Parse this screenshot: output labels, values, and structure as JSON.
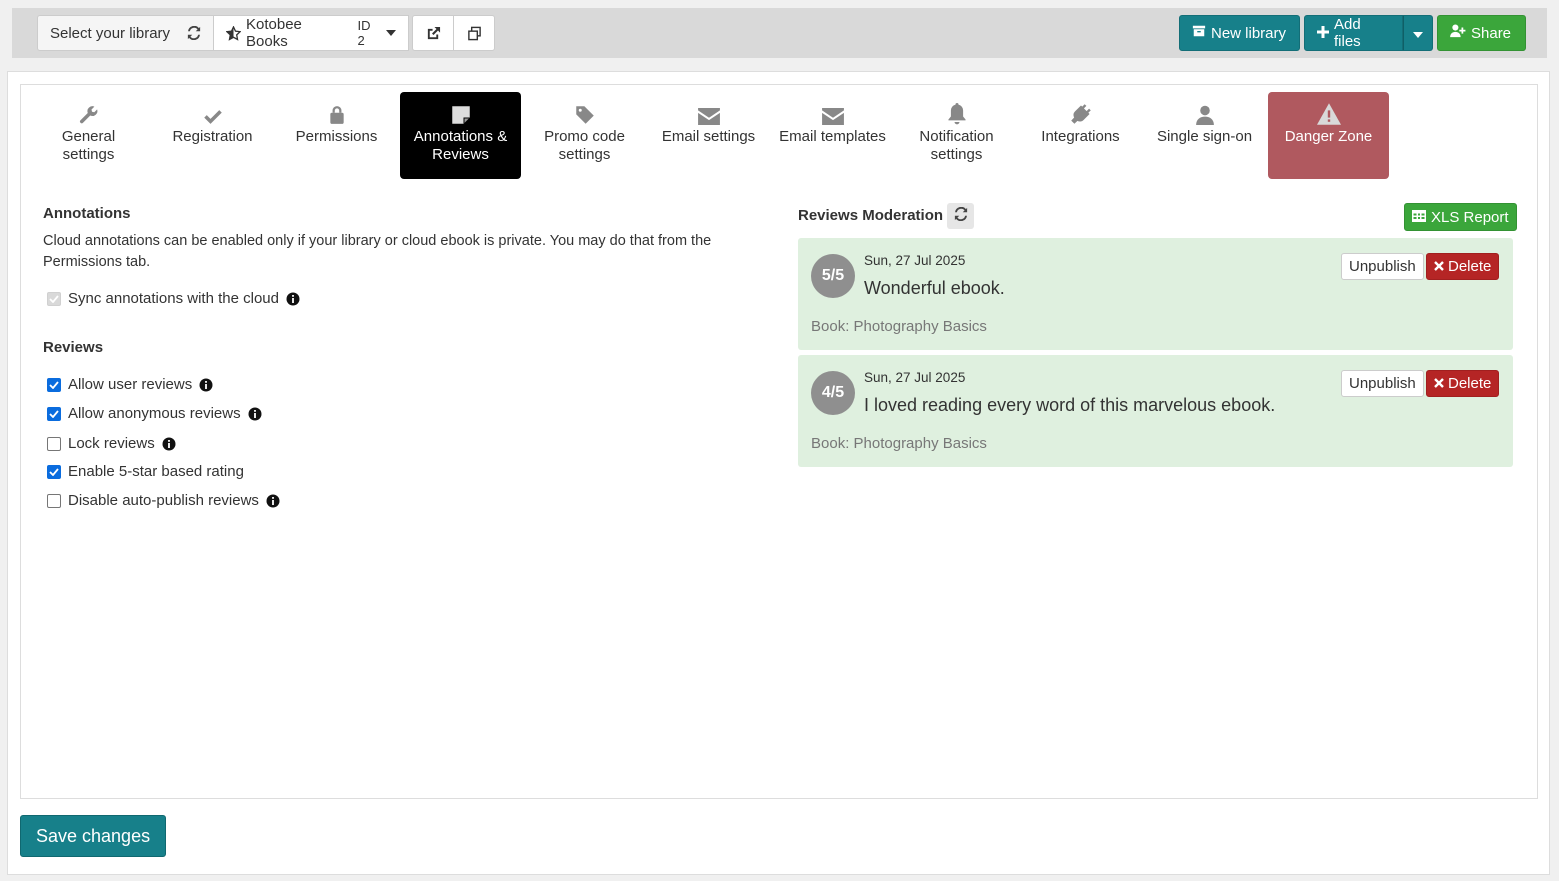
{
  "toolbar": {
    "select_library": "Select your library",
    "library_name": "Kotobee Books",
    "library_id": "ID 2",
    "new_library": "New library",
    "add_files": "Add files",
    "share": "Share"
  },
  "tabs": [
    {
      "label": "General settings",
      "icon": "wrench-icon"
    },
    {
      "label": "Registration",
      "icon": "check-icon"
    },
    {
      "label": "Permissions",
      "icon": "lock-icon"
    },
    {
      "label": "Annotations & Reviews",
      "icon": "note-icon",
      "active": true
    },
    {
      "label": "Promo code settings",
      "icon": "tag-icon"
    },
    {
      "label": "Email settings",
      "icon": "envelope-icon"
    },
    {
      "label": "Email templates",
      "icon": "envelope-icon"
    },
    {
      "label": "Notification settings",
      "icon": "bell-icon"
    },
    {
      "label": "Integrations",
      "icon": "plug-icon"
    },
    {
      "label": "Single sign-on",
      "icon": "user-icon"
    },
    {
      "label": "Danger Zone",
      "icon": "warning-icon"
    }
  ],
  "annotations": {
    "heading": "Annotations",
    "description": "Cloud annotations can be enabled only if your library or cloud ebook is private. You may do that from the Permissions tab.",
    "sync_label": "Sync annotations with the cloud"
  },
  "reviews": {
    "heading": "Reviews",
    "options": [
      {
        "label": "Allow user reviews",
        "checked": true
      },
      {
        "label": "Allow anonymous reviews",
        "checked": true
      },
      {
        "label": "Lock reviews",
        "checked": false
      },
      {
        "label": "Enable 5-star based rating",
        "checked": true
      },
      {
        "label": "Disable auto-publish reviews",
        "checked": false
      }
    ]
  },
  "moderation": {
    "heading": "Reviews Moderation",
    "xls_report": "XLS Report",
    "unpublish": "Unpublish",
    "delete": "Delete",
    "items": [
      {
        "rating": "5/5",
        "date": "Sun, 27 Jul 2025",
        "text": "Wonderful ebook.",
        "book": "Book: Photography Basics"
      },
      {
        "rating": "4/5",
        "date": "Sun, 27 Jul 2025",
        "text": "I loved reading every word of this marvelous ebook.",
        "book": "Book: Photography Basics"
      }
    ]
  },
  "save_label": "Save changes",
  "colors": {
    "teal": "#17808a",
    "green": "#3ba63b",
    "danger": "#b0595f",
    "delete": "#b52525",
    "review_bg": "#dff0df"
  }
}
